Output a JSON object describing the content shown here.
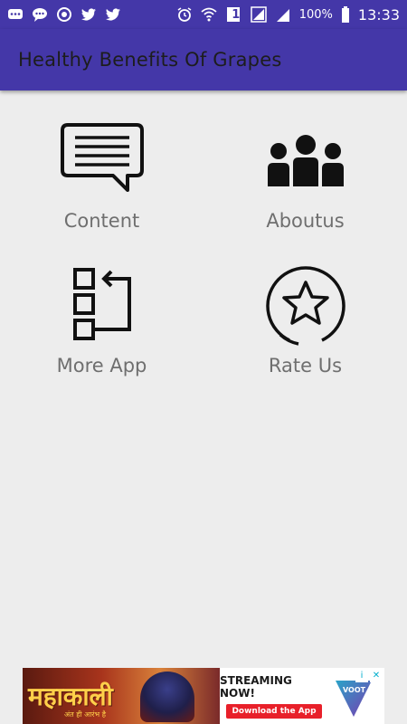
{
  "status_bar": {
    "left_icons": [
      "chat-bubble-icon",
      "message-icon",
      "sync-icon",
      "twitter-icon",
      "twitter-icon"
    ],
    "battery_percent": "100%",
    "sim_label": "1",
    "time": "13:33"
  },
  "app_bar": {
    "title": "Healthy Benefits Of Grapes",
    "background": "#4437a8"
  },
  "menu": {
    "items": [
      {
        "label": "Content",
        "icon": "message-box-icon"
      },
      {
        "label": "Aboutus",
        "icon": "group-icon"
      },
      {
        "label": "More App",
        "icon": "more-apps-icon"
      },
      {
        "label": "Rate Us",
        "icon": "star-icon"
      }
    ]
  },
  "ad": {
    "title": "महाकाली",
    "subtitle": "अंत ही आरंभ है",
    "headline": "STREAMING NOW!",
    "cta": "Download the App",
    "brand": "VOOT",
    "info": "i",
    "close": "✕"
  }
}
